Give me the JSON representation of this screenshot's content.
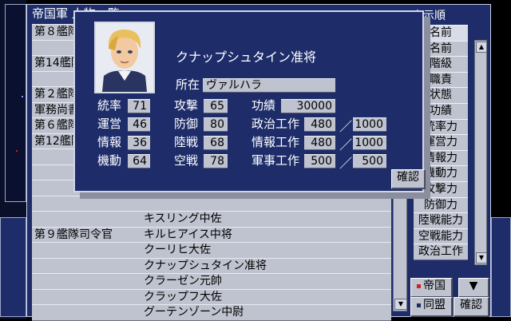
{
  "window": {
    "title": "帝国軍 人物一覧"
  },
  "list": {
    "rows": [
      {
        "position": "第８艦隊",
        "name": ""
      },
      {
        "position": "",
        "name": ""
      },
      {
        "position": "第14艦隊",
        "name": ""
      },
      {
        "position": "",
        "name": ""
      },
      {
        "position": "第２艦隊",
        "name": ""
      },
      {
        "position": "軍務尚書",
        "name": ""
      },
      {
        "position": "第６艦隊",
        "name": ""
      },
      {
        "position": "第12艦隊",
        "name": ""
      },
      {
        "position": "",
        "name": ""
      },
      {
        "position": "",
        "name": ""
      },
      {
        "position": "",
        "name": ""
      },
      {
        "position": "",
        "name": ""
      },
      {
        "position": "",
        "name": "キスリング中佐"
      },
      {
        "position": "第９艦隊司令官",
        "name": "キルヒアイス中将"
      },
      {
        "position": "",
        "name": "クーリヒ大佐"
      },
      {
        "position": "",
        "name": "クナップシュタイン准将"
      },
      {
        "position": "",
        "name": "クラーゼン元帥"
      },
      {
        "position": "",
        "name": "クラップフ大佐"
      },
      {
        "position": "",
        "name": "グーテンゾーン中尉"
      }
    ]
  },
  "sort": {
    "title": "表示順",
    "items": [
      "名前",
      "名前",
      "階級",
      "職責",
      "状態",
      "功績",
      "統率力",
      "運営力",
      "情報力",
      "機動力",
      "攻撃力",
      "防御力",
      "陸戦能力",
      "空戦能力",
      "政治工作"
    ]
  },
  "controls": {
    "empire": "帝国",
    "alliance": "同盟",
    "confirm": "確認",
    "down": "▼"
  },
  "detail": {
    "name": "クナップシュタイン准将",
    "location_label": "所在",
    "location": "ヴァルハラ",
    "stats": [
      {
        "label": "統率",
        "value": "71"
      },
      {
        "label": "運営",
        "value": "46"
      },
      {
        "label": "情報",
        "value": "36"
      },
      {
        "label": "機動",
        "value": "64"
      }
    ],
    "combat": [
      {
        "label": "攻撃",
        "value": "65"
      },
      {
        "label": "防御",
        "value": "80"
      },
      {
        "label": "陸戦",
        "value": "68"
      },
      {
        "label": "空戦",
        "value": "78"
      }
    ],
    "merit_label": "功績",
    "merit": "30000",
    "ops": [
      {
        "label": "政治工作",
        "value": "480",
        "max": "1000"
      },
      {
        "label": "情報工作",
        "value": "480",
        "max": "1000"
      },
      {
        "label": "軍事工作",
        "value": "500",
        "max": "500"
      }
    ],
    "slash": "／",
    "confirm": "確認"
  },
  "colors": {
    "panel": "#1e2d6a",
    "cell": "#bfc3cf",
    "text_light": "#ffffff"
  }
}
